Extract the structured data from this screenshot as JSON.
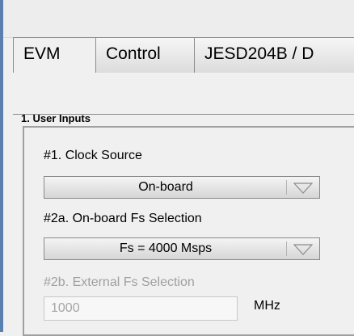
{
  "tabs": [
    {
      "label": "EVM",
      "active": true
    },
    {
      "label": "Control",
      "active": false
    },
    {
      "label": "JESD204B / D",
      "active": false
    }
  ],
  "section": {
    "title": "1. User Inputs"
  },
  "clock_source": {
    "label": "#1. Clock Source",
    "value": "On-board"
  },
  "fs_selection": {
    "label": "#2a. On-board Fs Selection",
    "value": "Fs = 4000 Msps"
  },
  "ext_fs": {
    "label": "#2b. External Fs Selection",
    "value": "1000",
    "unit": "MHz",
    "enabled": false
  },
  "colors": {
    "left_border": "#5a7fb0",
    "disabled_text": "#a0a0a0"
  }
}
